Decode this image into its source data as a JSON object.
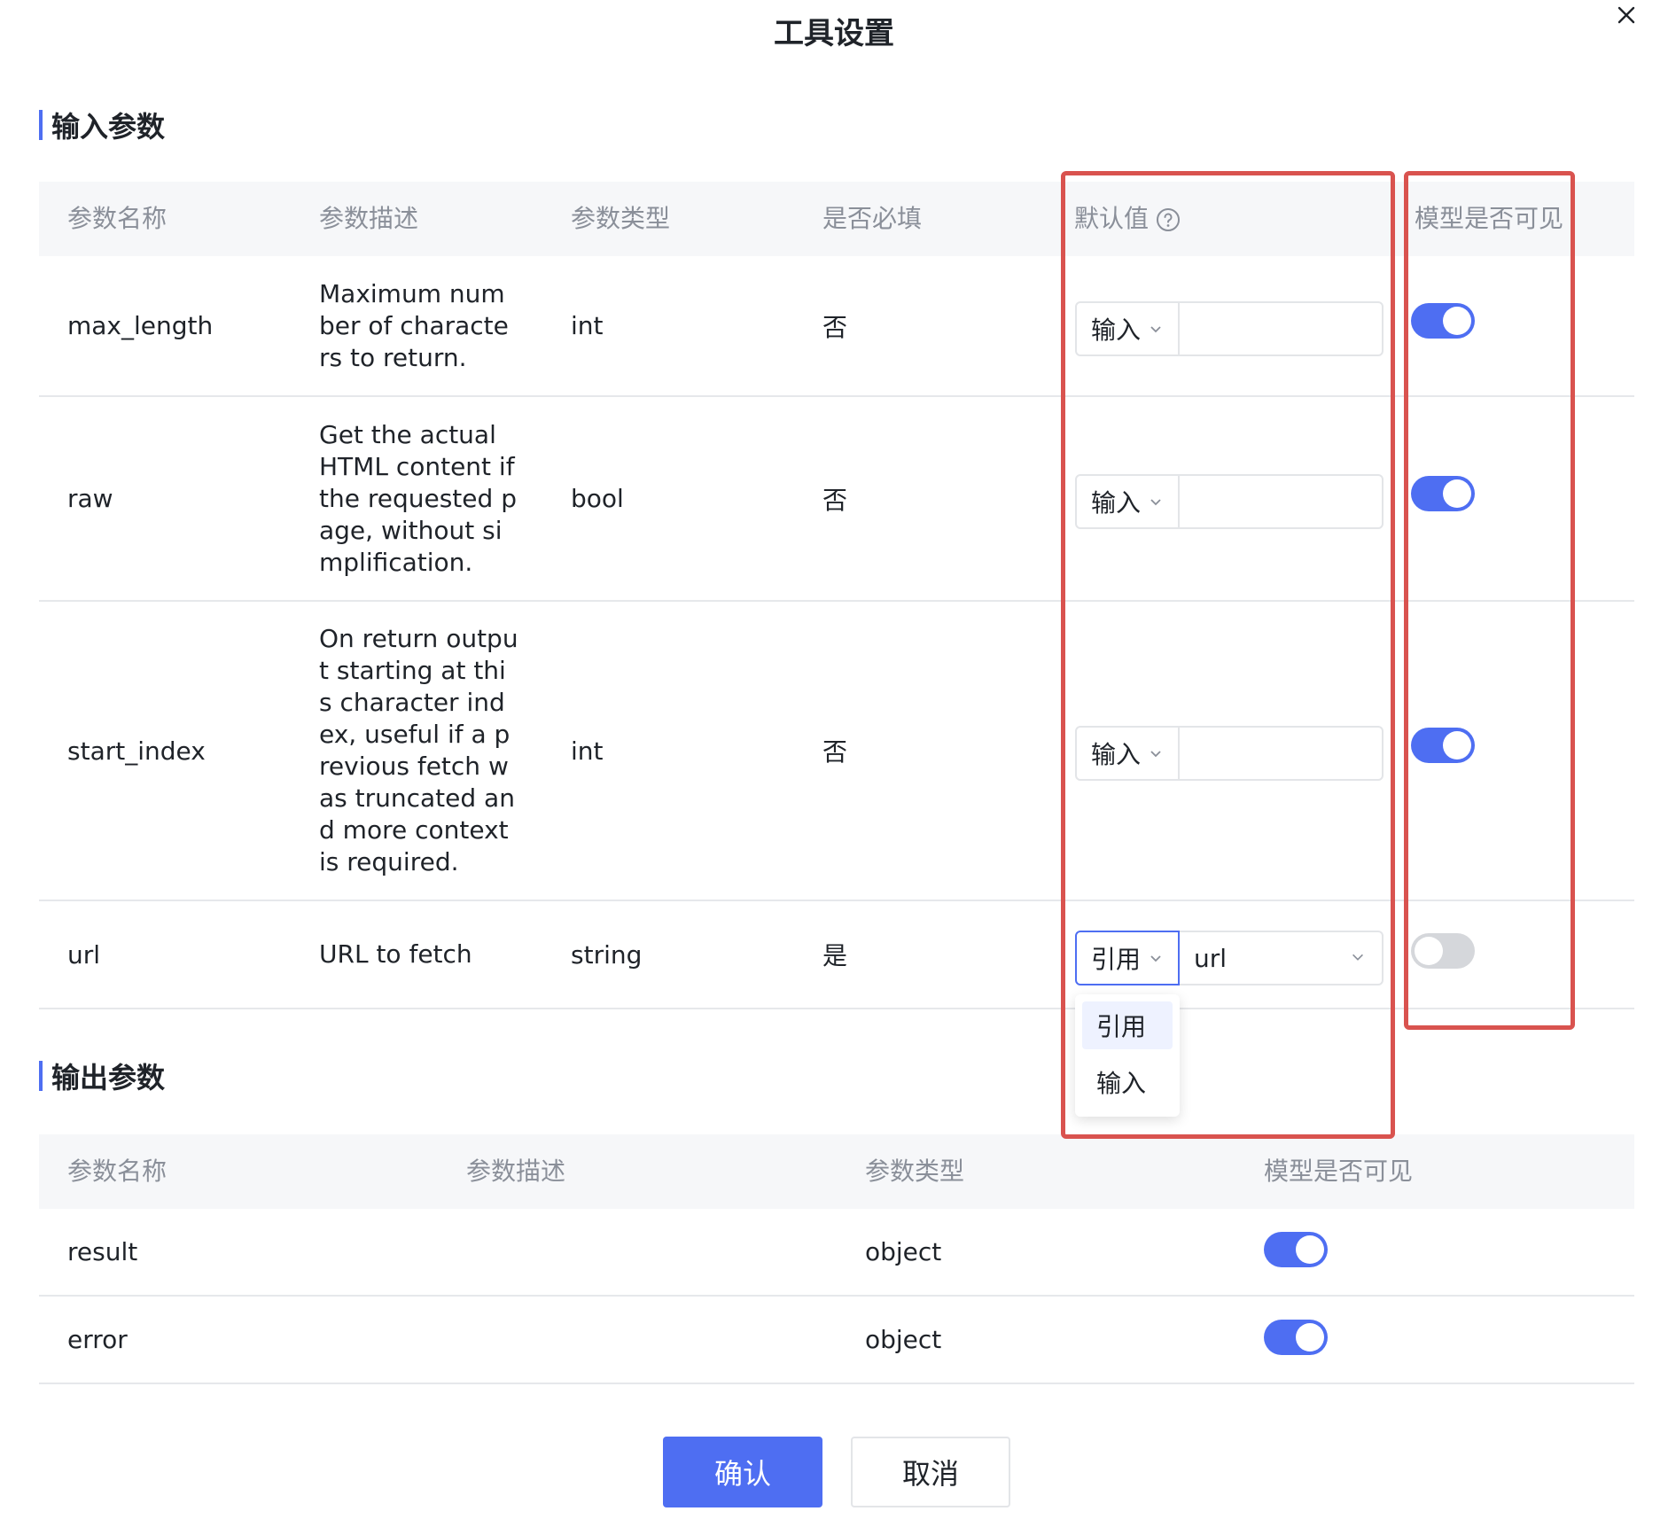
{
  "dialog": {
    "title": "工具设置"
  },
  "input_section": {
    "title": "输入参数",
    "headers": {
      "name": "参数名称",
      "desc": "参数描述",
      "type": "参数类型",
      "required": "是否必填",
      "default": "默认值",
      "visible": "模型是否可见"
    },
    "rows": [
      {
        "name": "max_length",
        "desc": "Maximum number of characters to return.",
        "type": "int",
        "required": "否",
        "mode": "输入",
        "value": "",
        "visible": true
      },
      {
        "name": "raw",
        "desc": "Get the actual HTML content if the requested page, without simplification.",
        "type": "bool",
        "required": "否",
        "mode": "输入",
        "value": "",
        "visible": true
      },
      {
        "name": "start_index",
        "desc": "On return output starting at this character index, useful if a previous fetch was truncated and more context is required.",
        "type": "int",
        "required": "否",
        "mode": "输入",
        "value": "",
        "visible": true
      },
      {
        "name": "url",
        "desc": "URL to fetch",
        "type": "string",
        "required": "是",
        "mode": "引用",
        "value": "url",
        "visible": false
      }
    ],
    "mode_dropdown": {
      "options": [
        "引用",
        "输入"
      ],
      "selected": "引用"
    }
  },
  "output_section": {
    "title": "输出参数",
    "headers": {
      "name": "参数名称",
      "desc": "参数描述",
      "type": "参数类型",
      "visible": "模型是否可见"
    },
    "rows": [
      {
        "name": "result",
        "desc": "",
        "type": "object",
        "visible": true
      },
      {
        "name": "error",
        "desc": "",
        "type": "object",
        "visible": true
      }
    ]
  },
  "actions": {
    "confirm": "确认",
    "cancel": "取消"
  },
  "icons": {
    "close": "close-icon",
    "help": "help-circle-icon",
    "chevron": "chevron-down-icon"
  },
  "colors": {
    "primary": "#4e6ef2",
    "highlight": "#d9534f",
    "toggle_off": "#d5d7db"
  }
}
